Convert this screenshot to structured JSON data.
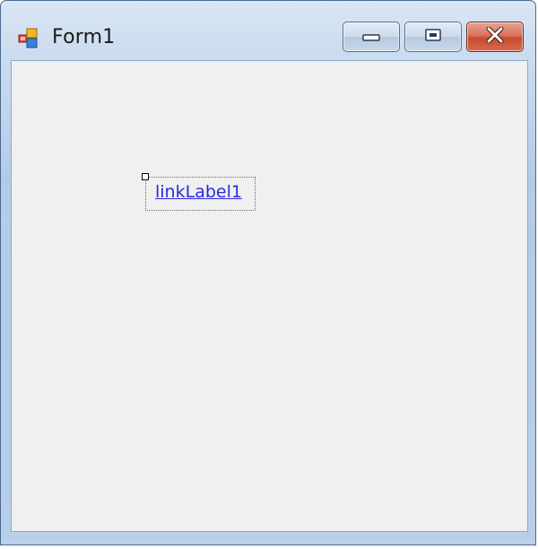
{
  "window": {
    "title": "Form1",
    "icon": "form-app-icon",
    "controls": {
      "minimize_icon": "minimize-icon",
      "maximize_icon": "maximize-icon",
      "close_icon": "close-icon"
    }
  },
  "form": {
    "link_label": "linkLabel1",
    "link_color": "#2a2ae0"
  }
}
